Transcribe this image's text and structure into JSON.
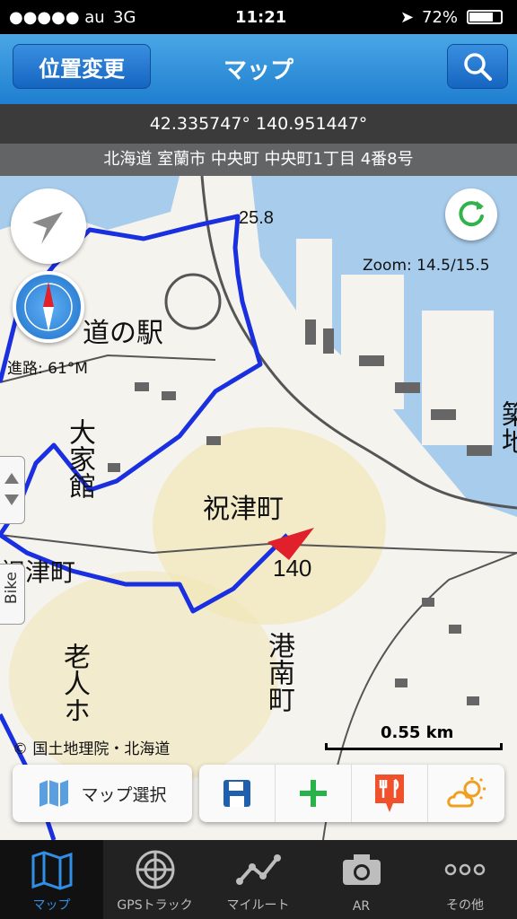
{
  "status_bar": {
    "carrier": "●●●●● au",
    "network": "3G",
    "time": "11:21",
    "battery": "72%"
  },
  "nav": {
    "location_button": "位置変更",
    "title": "マップ"
  },
  "coordinates": "42.335747° 140.951447°",
  "address": "北海道 室蘭市 中央町 中央町1丁目 4番8号",
  "map": {
    "zoom": "Zoom: 14.5/15.5",
    "heading": "進路: 61°M",
    "elevation": "25.8",
    "scale": "0.55 km",
    "copyright": "© 国土地理院・北海道",
    "bike_label": "Bike",
    "labels": {
      "michinoeki": "道の駅",
      "iwaizu_v": "祝津町",
      "iwaizu_left": "祝津町",
      "spot": "140",
      "minato": "港南町",
      "okina": "老人ホ",
      "daiko": "大家館",
      "right_edge": "築地"
    }
  },
  "toolbar": {
    "map_select": "マップ選択"
  },
  "tabs": [
    {
      "label": "マップ",
      "icon": "map-icon"
    },
    {
      "label": "GPSトラック",
      "icon": "radar-icon"
    },
    {
      "label": "マイルート",
      "icon": "route-icon"
    },
    {
      "label": "AR",
      "icon": "camera-icon"
    },
    {
      "label": "その他",
      "icon": "more-icon"
    }
  ],
  "colors": {
    "accent": "#2f8fe6",
    "track": "#1a2fe0",
    "sea": "#a8cdec"
  }
}
